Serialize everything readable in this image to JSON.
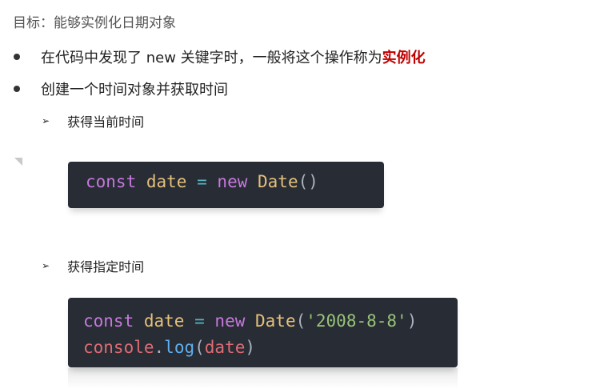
{
  "objective": {
    "text": "目标：能够实例化日期对象"
  },
  "bullets": [
    {
      "text": "在代码中发现了 new 关键字时，一般将这个操作称为",
      "emphasis": "实例化"
    },
    {
      "text": "创建一个时间对象并获取时间"
    }
  ],
  "subitems": [
    {
      "arrow": "➢",
      "text": "获得当前时间"
    },
    {
      "arrow": "➢",
      "text": "获得指定时间"
    }
  ],
  "code1": {
    "line1": {
      "kw": "const",
      "var": "date",
      "op": "=",
      "kw2": "new",
      "cls": "Date",
      "punc": "()"
    }
  },
  "code2": {
    "line1": {
      "kw": "const",
      "var": "date",
      "op": "=",
      "kw2": "new",
      "cls": "Date",
      "open": "(",
      "str": "'2008-8-8'",
      "close": ")"
    },
    "line2": {
      "obj": "console",
      "dot": ".",
      "fn": "log",
      "open": "(",
      "arg": "date",
      "close": ")"
    }
  },
  "colors": {
    "emphasis": "#c00000",
    "code_bg": "#282c34",
    "keyword": "#c678dd",
    "variable": "#e5c07b",
    "operator": "#56b6c2",
    "string": "#98c379",
    "object": "#e06c75",
    "function": "#61afef"
  }
}
